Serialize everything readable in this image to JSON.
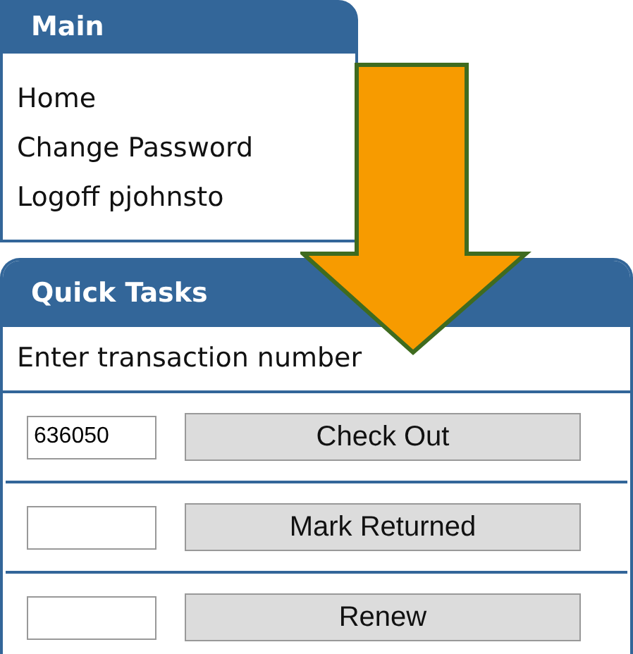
{
  "main_panel": {
    "title": "Main",
    "links": [
      {
        "label": "Home"
      },
      {
        "label": "Change Password"
      },
      {
        "label": "Logoff pjohnsto"
      }
    ]
  },
  "quick_tasks": {
    "title": "Quick Tasks",
    "prompt": "Enter transaction number",
    "rows": [
      {
        "value": "636050",
        "button": "Check Out"
      },
      {
        "button": "Mark Returned"
      },
      {
        "button": "Renew"
      }
    ]
  },
  "overlay": {
    "kind": "down-arrow"
  }
}
